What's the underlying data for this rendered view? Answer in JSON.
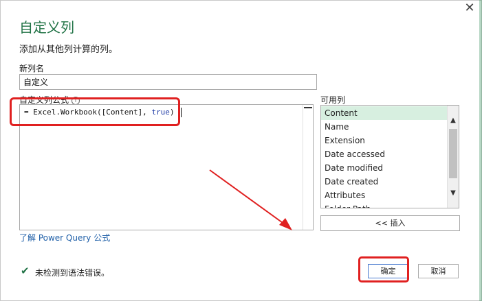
{
  "dialog": {
    "title": "自定义列",
    "subtitle": "添加从其他列计算的列。",
    "close_glyph": "✕"
  },
  "new_column": {
    "label": "新列名",
    "value": "自定义"
  },
  "formula": {
    "label": "自定义列公式",
    "info_glyph": "i",
    "prefix": "= Excel.Workbook([Content], ",
    "keyword": "true",
    "suffix": ")"
  },
  "available_columns": {
    "label": "可用列",
    "items": [
      "Content",
      "Name",
      "Extension",
      "Date accessed",
      "Date modified",
      "Date created",
      "Attributes",
      "Folder Path"
    ],
    "selected": "Content",
    "insert_label": "<< 插入"
  },
  "learn_link": "了解 Power Query 公式",
  "status": {
    "icon": "check-icon",
    "text": "未检测到语法错误。"
  },
  "buttons": {
    "ok": "确定",
    "cancel": "取消"
  },
  "colors": {
    "accent": "#217346",
    "annotation": "#e02020",
    "selected_row": "#d7efe0",
    "link": "#1f5fa8"
  }
}
